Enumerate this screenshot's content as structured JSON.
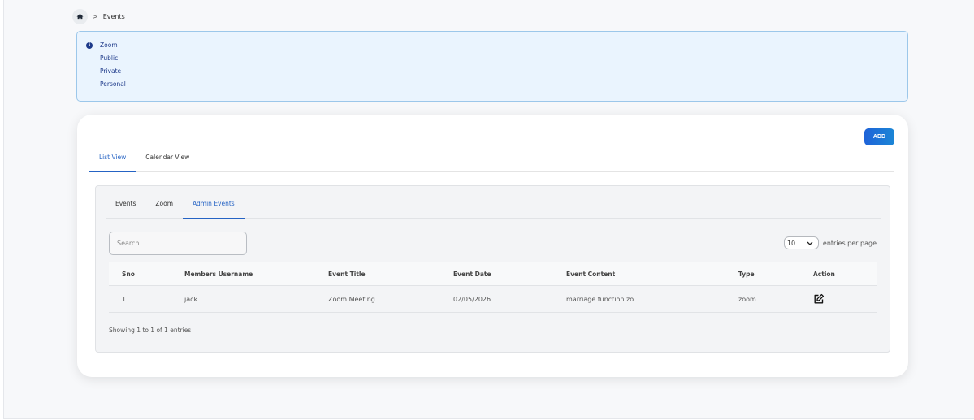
{
  "breadcrumb": {
    "separator": ">",
    "current": "Events"
  },
  "alert": {
    "items": [
      "Zoom",
      "Public",
      "Private",
      "Personal"
    ]
  },
  "card": {
    "add_label": "ADD",
    "main_tabs": [
      {
        "label": "List View",
        "active": true
      },
      {
        "label": "Calendar View",
        "active": false
      }
    ],
    "sub_tabs": [
      {
        "label": "Events",
        "active": false
      },
      {
        "label": "Zoom",
        "active": false
      },
      {
        "label": "Admin Events",
        "active": true
      }
    ],
    "search_placeholder": "Search...",
    "entries_value": "10",
    "entries_label": "entries per page",
    "table": {
      "columns": [
        "Sno",
        "Members Username",
        "Event Title",
        "Event Date",
        "Event Content",
        "Type",
        "Action"
      ],
      "rows": [
        {
          "sno": "1",
          "username": "jack",
          "title": "Zoom Meeting",
          "date": "02/05/2026",
          "content": "marriage function zo...",
          "type": "zoom"
        }
      ]
    },
    "showing_text": "Showing 1 to 1 of 1 entries"
  },
  "colors": {
    "accent": "#2563c4",
    "alert_bg": "#eaf4fe",
    "alert_text": "#1e3a8a"
  },
  "icons": [
    "home-icon",
    "info-icon",
    "chevron-down-icon",
    "edit-icon"
  ]
}
